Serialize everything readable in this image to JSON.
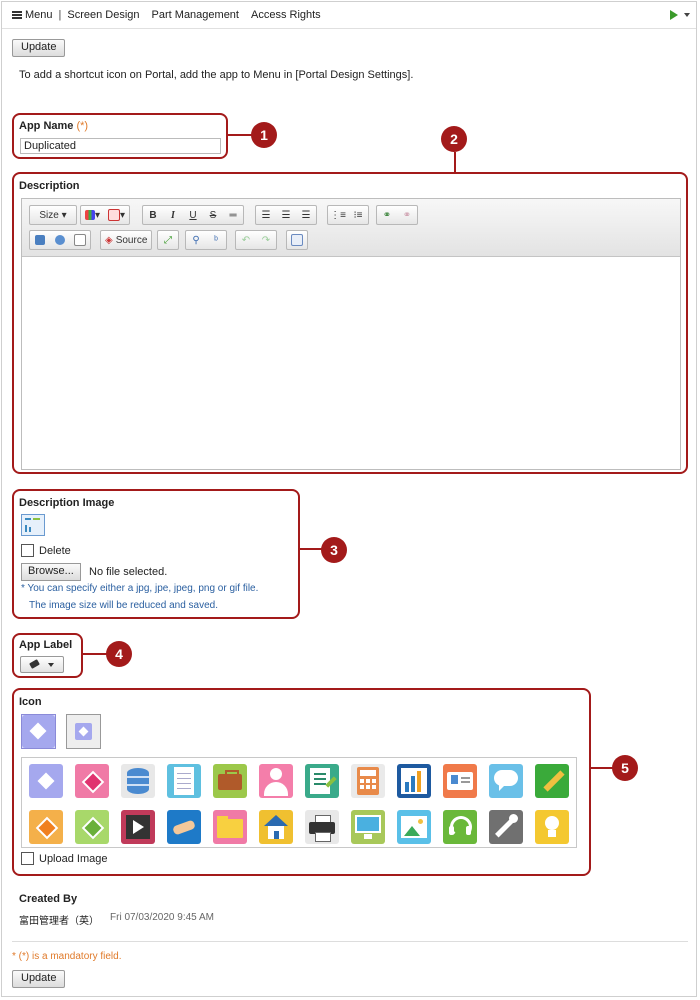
{
  "topbar": {
    "menu_label": "Menu",
    "separator": "|",
    "nav": [
      "Screen Design",
      "Part Management",
      "Access Rights"
    ]
  },
  "update_label": "Update",
  "notice": "To add a shortcut icon on Portal, add the app to Menu in [Portal Design Settings].",
  "app_name": {
    "label": "App Name",
    "required_mark": "(*)",
    "value": "Duplicated"
  },
  "description": {
    "label": "Description",
    "toolbar": {
      "size_label": "Size",
      "bold": "B",
      "italic": "I",
      "underline": "U",
      "strike": "S",
      "source_label": "Source"
    }
  },
  "description_image": {
    "label": "Description Image",
    "delete_label": "Delete",
    "browse_label": "Browse...",
    "file_status": "No file selected.",
    "note_line1": "* You can specify either a jpg, jpe, jpeg, png or gif file.",
    "note_line2": "The image size will be reduced and saved."
  },
  "app_label": {
    "label": "App Label"
  },
  "icon": {
    "label": "Icon",
    "upload_label": "Upload Image",
    "icons_row1": [
      "diamond-blue",
      "diamond-pink",
      "database",
      "document",
      "briefcase",
      "person",
      "chart-edit",
      "calculator",
      "bar-chart",
      "id-card",
      "speech-bubble",
      "pencil"
    ],
    "icons_row2": [
      "diamond-orange",
      "diamond-green",
      "film",
      "handshake",
      "folder",
      "house",
      "printer",
      "monitor",
      "picture",
      "headset",
      "wrench",
      "lightbulb"
    ]
  },
  "created_by": {
    "label": "Created By",
    "user": "富田管理者（英）",
    "timestamp": "Fri 07/03/2020 9:45 AM"
  },
  "mandatory_note": "* (*) is a mandatory field.",
  "callouts": [
    "1",
    "2",
    "3",
    "4",
    "5"
  ],
  "colors": {
    "callout": "#a31a1a",
    "note": "#2a5fa0",
    "mandatory": "#e07a2a"
  }
}
